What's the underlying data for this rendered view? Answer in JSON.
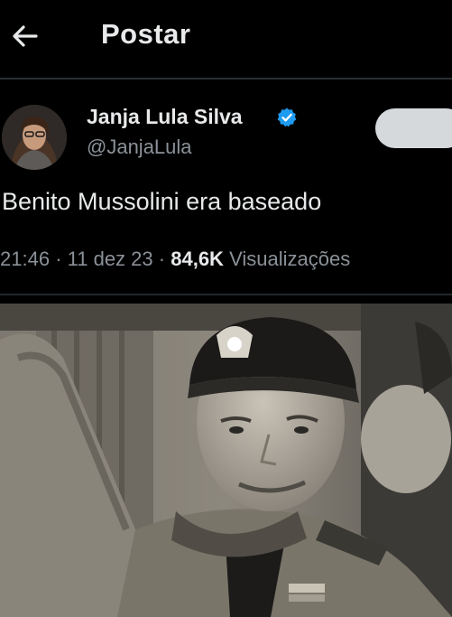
{
  "header": {
    "back_icon": "arrow-left-icon",
    "title": "Postar"
  },
  "tweet": {
    "author_name": "Janja Lula Silva",
    "verified_icon": "verified-badge-icon",
    "verified_color": "#1d9bf0",
    "handle": "@JanjaLula",
    "text": "Benito Mussolini era baseado",
    "time": "21:46",
    "date": "11 dez 23",
    "separator": "·",
    "views_count": "84,6K",
    "views_label": "Visualizações"
  },
  "colors": {
    "background": "#000000",
    "text_primary": "#e7e9ea",
    "text_secondary": "#8b9198",
    "divider": "#2a2d31"
  }
}
